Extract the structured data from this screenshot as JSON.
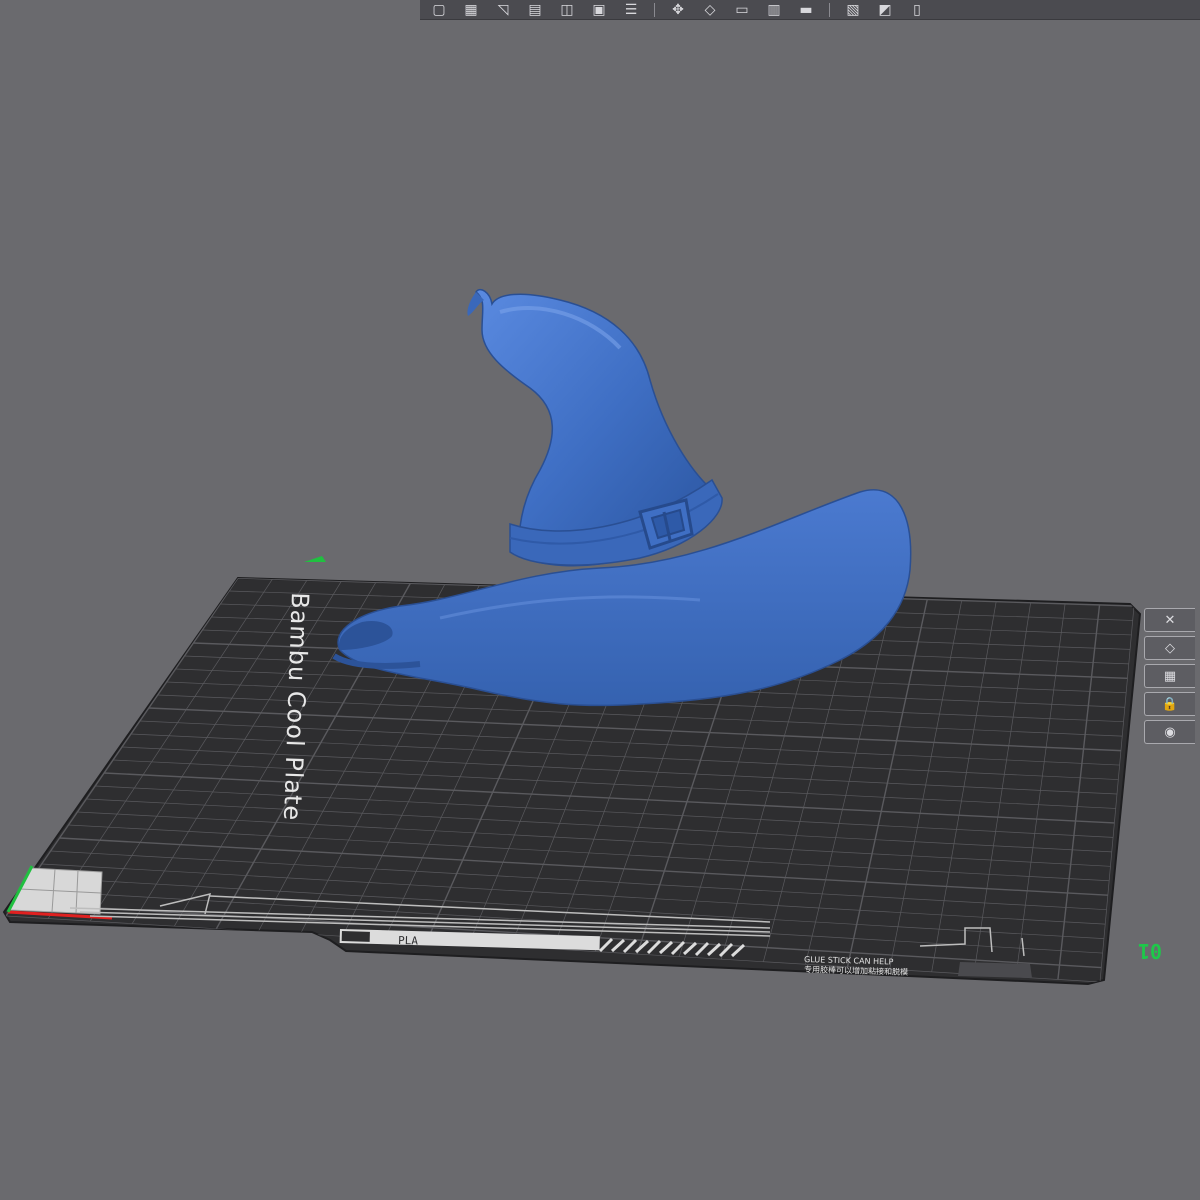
{
  "plate": {
    "name_label": "Bambu Cool Plate",
    "filament_label": "PLA",
    "hint_en": "GLUE STICK CAN HELP",
    "hint_cn": "专用胶棒可以增加粘接和脱模",
    "number": "01",
    "color": "#2e2e30",
    "grid_color": "#5a5a5e"
  },
  "model": {
    "name": "witch-hat",
    "color": "#3f6fc4"
  },
  "colors": {
    "background": "#6a6a6e",
    "axis_x": "#e02020",
    "axis_y": "#20c040",
    "plate_number": "#1ec84a"
  },
  "toolbar": {
    "buttons": [
      {
        "icon": "add-plate-icon",
        "glyph": "▢"
      },
      {
        "icon": "arrange-icon",
        "glyph": "▦"
      },
      {
        "icon": "orient-icon",
        "glyph": "◹"
      },
      {
        "icon": "layout-icon",
        "glyph": "▤"
      },
      {
        "icon": "split-icon",
        "glyph": "◫"
      },
      {
        "icon": "object-icon",
        "glyph": "▣"
      },
      {
        "icon": "list-icon",
        "glyph": "☰"
      },
      {
        "icon": "move-icon",
        "glyph": "✥"
      },
      {
        "icon": "rotate-icon",
        "glyph": "◇"
      },
      {
        "icon": "scale-icon",
        "glyph": "▭"
      },
      {
        "icon": "lay-on-face-icon",
        "glyph": "▥"
      },
      {
        "icon": "cut-icon",
        "glyph": "▬"
      },
      {
        "icon": "support-paint-icon",
        "glyph": "▧"
      },
      {
        "icon": "seam-paint-icon",
        "glyph": "◩"
      },
      {
        "icon": "measure-icon",
        "glyph": "▯"
      }
    ]
  },
  "side_toolbar": {
    "buttons": [
      {
        "icon": "close-icon",
        "glyph": "✕"
      },
      {
        "icon": "auto-orient-icon",
        "glyph": "◇"
      },
      {
        "icon": "plate-settings-icon",
        "glyph": "▦"
      },
      {
        "icon": "lock-icon",
        "glyph": "🔒"
      },
      {
        "icon": "eye-icon",
        "glyph": "◉"
      }
    ]
  }
}
